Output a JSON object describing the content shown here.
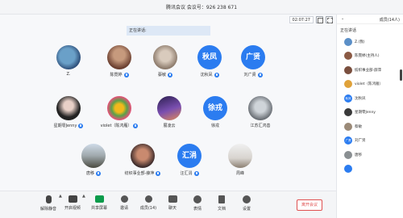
{
  "window": {
    "title": "腾讯会议 会议号：926 238 671"
  },
  "main": {
    "timer": "02:07:27",
    "speaking_label": "正在讲话:",
    "participants": [
      {
        "name": "Z.",
        "avatar": "photo",
        "mic": false
      },
      {
        "name": "陈霓婷",
        "avatar": "photo",
        "mic": true
      },
      {
        "name": "蔡敏",
        "avatar": "photo",
        "mic": true
      },
      {
        "name": "沈秋凤",
        "avatar": "text",
        "avatar_text": "秋凤",
        "mic": true
      },
      {
        "name": "刘广贤",
        "avatar": "text",
        "avatar_text": "广贤",
        "mic": true
      },
      {
        "name": "星期零Jenny",
        "avatar": "photo",
        "mic": true
      },
      {
        "name": "violet（陈鸿雁）",
        "avatar": "photo",
        "mic": true
      },
      {
        "name": "展凌云",
        "avatar": "photo",
        "mic": false
      },
      {
        "name": "徐戎",
        "avatar": "text",
        "avatar_text": "徐戎",
        "mic": false
      },
      {
        "name": "江苏汇鸿善",
        "avatar": "photo",
        "mic": false
      },
      {
        "name": "唐移",
        "avatar": "photo",
        "mic": true
      },
      {
        "name": "纺织事业部-薛萍",
        "avatar": "photo",
        "mic": true
      },
      {
        "name": "汪汇涓",
        "avatar": "text",
        "avatar_text": "汇涓",
        "mic": true
      },
      {
        "name": "周峰",
        "avatar": "photo",
        "mic": false
      }
    ]
  },
  "toolbar": {
    "mute": "解除静音",
    "video": "开启视频",
    "share": "共享屏幕",
    "invite": "邀请",
    "members": "成员(14)",
    "chat": "聊天",
    "reactions": "表情",
    "docs": "文档",
    "settings": "设置",
    "leave": "离开会议"
  },
  "panel": {
    "title": "成员(14人)",
    "speaking_label": "正在讲话",
    "members": [
      {
        "name": "Z.(我)",
        "color": "#5b8fc7"
      },
      {
        "name": "陈霓婷(主持人)",
        "color": "#8b5a44"
      },
      {
        "name": "纺织事业部-薛萍",
        "color": "#7a4f3e"
      },
      {
        "name": "violet（陈鸿雁）",
        "color": "#e0a23a"
      },
      {
        "name": "沈秋凤",
        "color": "#2b7cf0",
        "text": "秋凤"
      },
      {
        "name": "星期零Jenny",
        "color": "#3a3a3a"
      },
      {
        "name": "蔡敏",
        "color": "#9b8a78"
      },
      {
        "name": "刘广贤",
        "color": "#2b7cf0",
        "text": "广贤"
      },
      {
        "name": "唐移",
        "color": "#8a8f92"
      },
      {
        "name": "",
        "color": "#2b7cf0"
      }
    ]
  },
  "colors": {
    "accent": "#2b7cf0",
    "leave": "#e05050",
    "share": "#0a9b4b"
  }
}
